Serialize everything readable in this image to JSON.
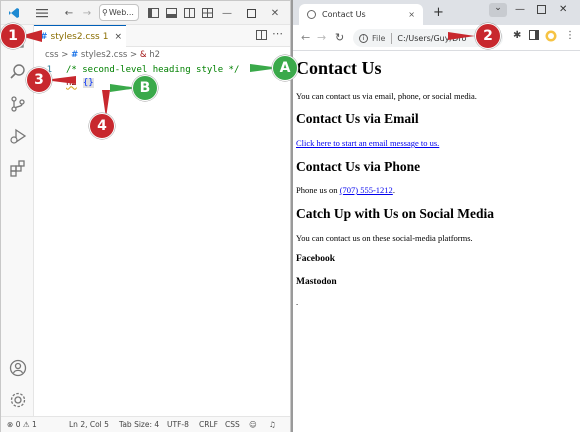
{
  "vscode": {
    "search_label": "Web...",
    "tab": {
      "filename": "styles2.css",
      "problem_count": "1",
      "close": "×"
    },
    "breadcrumb": {
      "folder": "css",
      "sep": ">",
      "file": "styles2.css",
      "selector": "h2"
    },
    "editor": {
      "line1_number": "1",
      "line1_text": "/* second-level heading style */",
      "line2_selector": "h2",
      "line2_brace": "{}"
    },
    "statusbar": {
      "errors": "0",
      "warnings": "1",
      "position": "Ln 2, Col 5",
      "tabsize": "Tab Size: 4",
      "encoding": "UTF-8",
      "eol": "CRLF",
      "language": "CSS"
    }
  },
  "browser": {
    "tab_title": "Contact Us",
    "tab_close": "×",
    "new_tab": "+",
    "address_scheme": "File",
    "address_path": "C:/Users/Guy/Dro",
    "page": {
      "h1": "Contact Us",
      "intro": "You can contact us via email, phone, or social media.",
      "h2_email": "Contact Us via Email",
      "email_link": "Click here to start an email message to us.",
      "h2_phone": "Contact Us via Phone",
      "phone_prefix": "Phone us on",
      "phone_number": "(707) 555-1212",
      "phone_suffix": ".",
      "h2_social": "Catch Up with Us on Social Media",
      "social_text": "You can contact us on these social-media platforms.",
      "h3_facebook": "Facebook",
      "h3_mastodon": "Mastodon",
      "trailing": "."
    }
  },
  "callouts": {
    "c1": "1",
    "c2": "2",
    "c3": "3",
    "c4": "4",
    "cA": "A",
    "cB": "B"
  },
  "colors": {
    "callout_red": "#c8282e",
    "callout_green": "#3aa94a",
    "vscode_accent": "#005fb8",
    "comment_green": "#008000"
  }
}
